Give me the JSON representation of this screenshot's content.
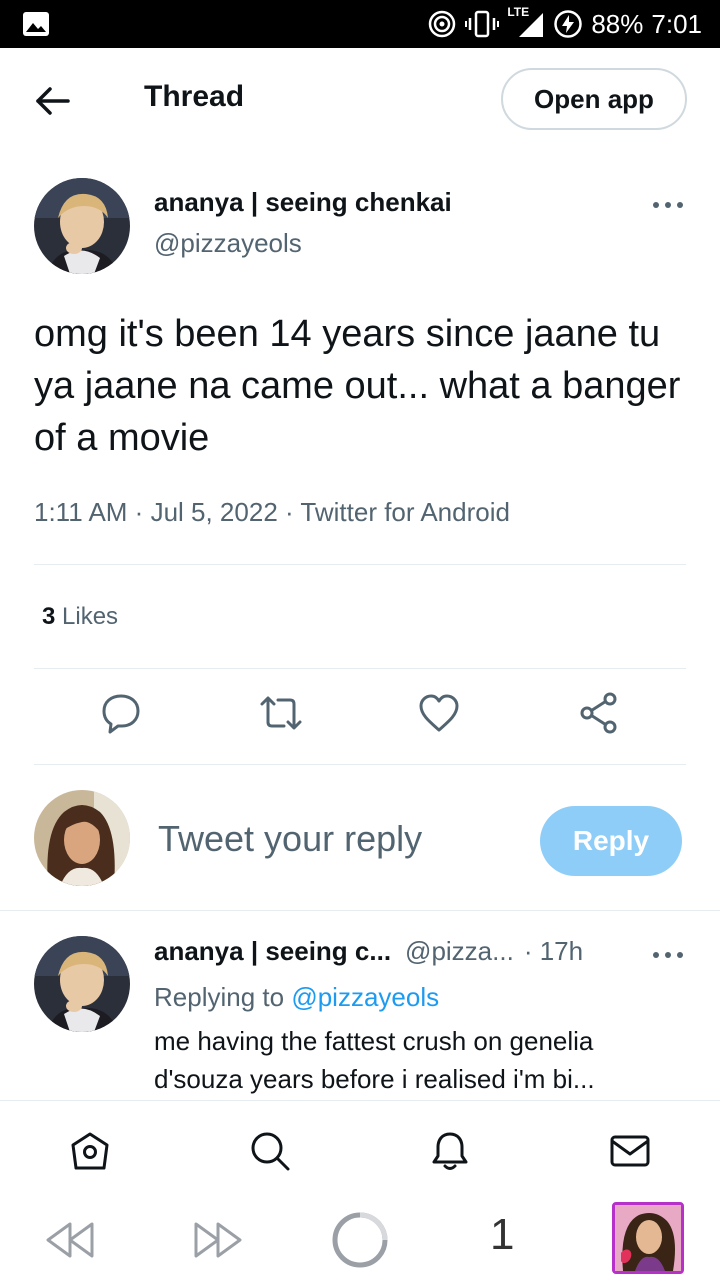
{
  "status_bar": {
    "battery": "88%",
    "time": "7:01",
    "network": "LTE"
  },
  "header": {
    "title": "Thread",
    "open_app": "Open app"
  },
  "tweet": {
    "display_name": "ananya | seeing chenkai",
    "handle": "@pizzayeols",
    "text": "omg it's been 14 years since jaane tu ya jaane na came out... what a banger of a movie",
    "meta": "1:11 AM · Jul 5, 2022 · Twitter for Android",
    "likes_count": "3",
    "likes_label": "Likes"
  },
  "composer": {
    "placeholder": "Tweet your reply",
    "reply_button": "Reply"
  },
  "reply_tweet": {
    "display_name": "ananya | seeing c...",
    "handle": "@pizza...",
    "time": "· 17h",
    "replying_prefix": "Replying to",
    "replying_handle": "@pizzayeols",
    "text": "me having the fattest crush on genelia d'souza years before i realised i'm bi..."
  },
  "browser": {
    "tab_count": "1"
  },
  "colors": {
    "accent": "#1d9bf0",
    "reply_button": "#8ecdf7",
    "secondary_text": "#536471",
    "primary_text": "#0f1419",
    "profile_border": "#b531c7"
  }
}
